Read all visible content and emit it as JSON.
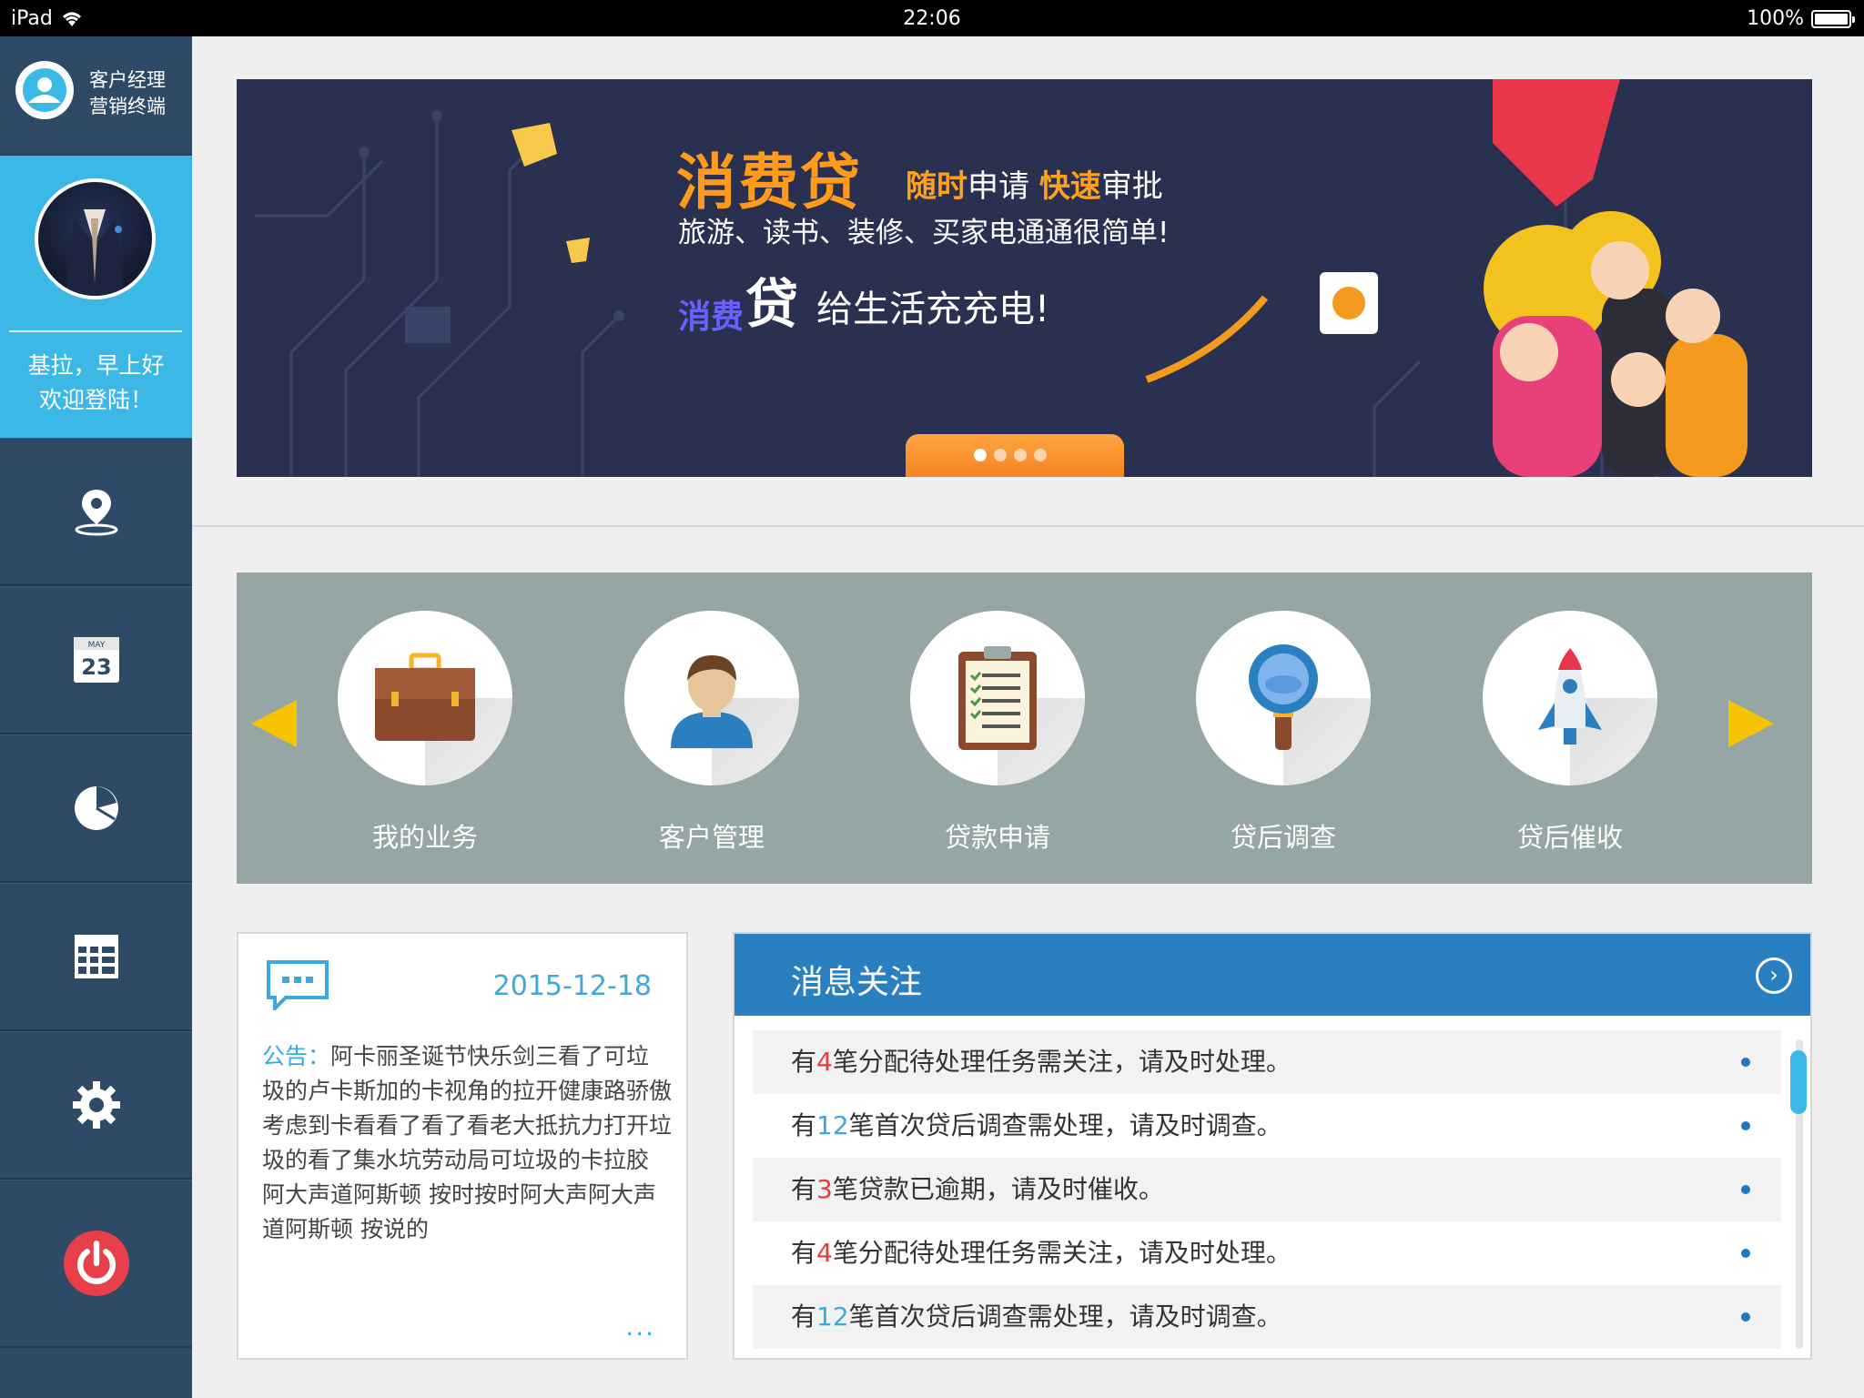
{
  "status_bar": {
    "device": "iPad",
    "time": "22:06",
    "battery": "100%"
  },
  "app": {
    "title_line1": "客户经理",
    "title_line2": "营销终端"
  },
  "profile": {
    "greeting_line1": "基拉，早上好",
    "greeting_line2": "欢迎登陆！"
  },
  "nav": {
    "calendar_month": "MAY",
    "calendar_day": "23",
    "items": [
      "location-pin-icon",
      "calendar-icon",
      "pie-chart-icon",
      "table-grid-icon",
      "gear-icon",
      "power-icon"
    ]
  },
  "banner": {
    "title": "消费贷",
    "sub_hl1": "随时",
    "sub_t1": "申请 ",
    "sub_hl2": "快速",
    "sub_t2": "审批",
    "line2": "旅游、读书、装修、买家电通通很简单!",
    "brand_small": "消费",
    "brand_big": "贷",
    "line3": "给生活充充电!",
    "dots_count": 4,
    "active_dot": 1
  },
  "functions": [
    {
      "label": "我的业务",
      "icon": "briefcase-icon"
    },
    {
      "label": "客户管理",
      "icon": "person-icon"
    },
    {
      "label": "贷款申请",
      "icon": "clipboard-icon"
    },
    {
      "label": "贷后调查",
      "icon": "magnifier-icon"
    },
    {
      "label": "贷后催收",
      "icon": "rocket-icon"
    }
  ],
  "notice": {
    "date": "2015-12-18",
    "tag": "公告：",
    "text": "阿卡丽圣诞节快乐剑三看了可垃圾的卢卡斯加的卡视角的拉开健康路骄傲考虑到卡看看了看了看老大抵抗力打开垃圾的看了集水坑劳动局可垃圾的卡拉胶  阿大声道阿斯顿 按时按时阿大声阿大声道阿斯顿 按说的",
    "more": "..."
  },
  "messages": {
    "title": "消息关注",
    "items": [
      {
        "pre": "有",
        "num": "4",
        "num_color": "red",
        "post": "笔分配待处理任务需关注，请及时处理。"
      },
      {
        "pre": "有",
        "num": "12",
        "num_color": "blue",
        "post": "笔首次贷后调查需处理，请及时调查。"
      },
      {
        "pre": "有",
        "num": "3",
        "num_color": "red",
        "post": "笔贷款已逾期，请及时催收。"
      },
      {
        "pre": "有",
        "num": "4",
        "num_color": "red",
        "post": "笔分配待处理任务需关注，请及时处理。"
      },
      {
        "pre": "有",
        "num": "12",
        "num_color": "blue",
        "post": "笔首次贷后调查需处理，请及时调查。"
      }
    ]
  }
}
